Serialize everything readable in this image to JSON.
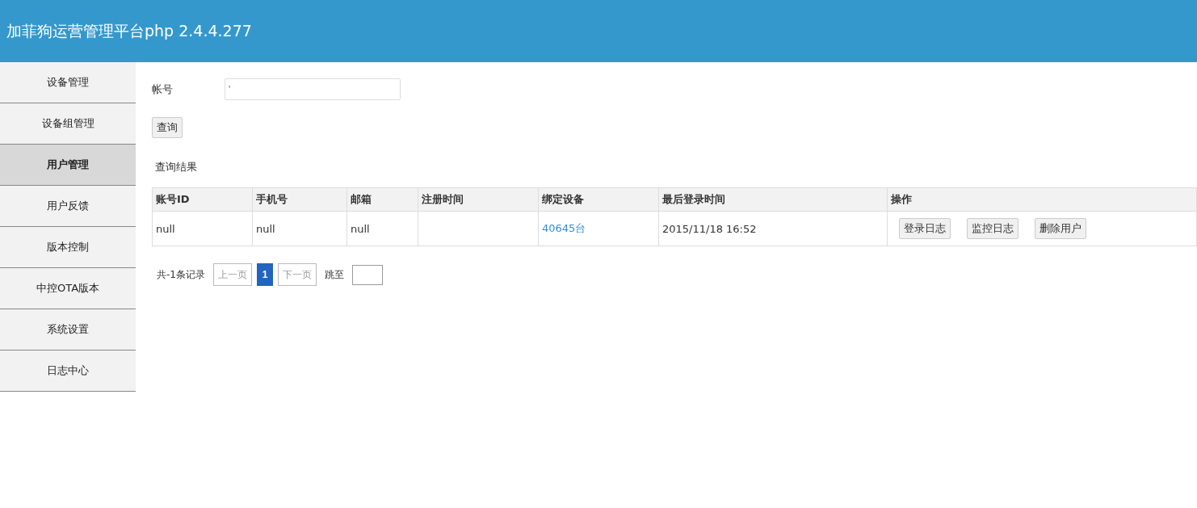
{
  "header": {
    "title": "加菲狗运营管理平台php 2.4.4.277"
  },
  "sidebar": {
    "items": [
      {
        "label": "设备管理",
        "selected": false
      },
      {
        "label": "设备组管理",
        "selected": false
      },
      {
        "label": "用户管理",
        "selected": true
      },
      {
        "label": "用户反馈",
        "selected": false
      },
      {
        "label": "版本控制",
        "selected": false
      },
      {
        "label": "中控OTA版本",
        "selected": false
      },
      {
        "label": "系统设置",
        "selected": false
      },
      {
        "label": "日志中心",
        "selected": false
      }
    ]
  },
  "search": {
    "label": "帐号",
    "value": "'",
    "button": "查询"
  },
  "results": {
    "title": "查询结果",
    "columns": [
      "账号ID",
      "手机号",
      "邮箱",
      "注册时间",
      "绑定设备",
      "最后登录时间",
      "操作"
    ],
    "rows": [
      {
        "cells": [
          "null",
          "null",
          "null",
          "",
          "40645台",
          "2015/11/18 16:52"
        ],
        "actions": [
          "登录日志",
          "监控日志",
          "删除用户"
        ]
      }
    ]
  },
  "pagination": {
    "summary": "共-1条记录",
    "prev": "上一页",
    "pages": [
      {
        "label": "1",
        "selected": true
      }
    ],
    "next": "下一页",
    "jump_label": "跳至"
  }
}
